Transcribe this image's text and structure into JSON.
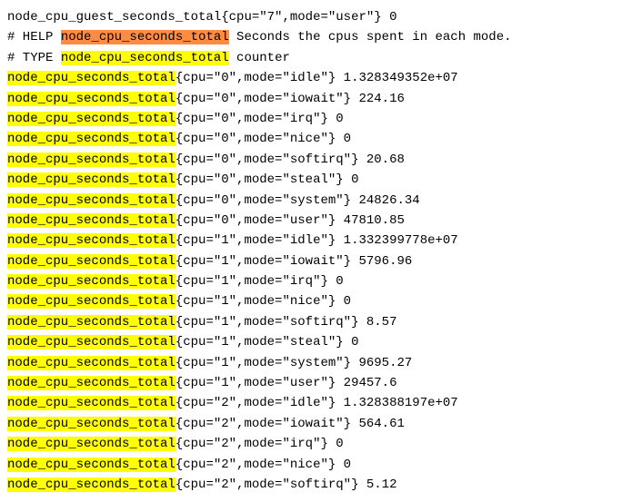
{
  "metric_name": "node_cpu_seconds_total",
  "guest_metric_name": "node_cpu_guest_seconds_total",
  "help_prefix": "# HELP ",
  "help_text": " Seconds the cpus spent in each mode.",
  "type_prefix": "# TYPE ",
  "type_value": " counter",
  "guest_line_suffix": "{cpu=\"7\",mode=\"user\"} 0",
  "metrics": [
    {
      "cpu": "0",
      "mode": "idle",
      "value": "1.328349352e+07"
    },
    {
      "cpu": "0",
      "mode": "iowait",
      "value": "224.16"
    },
    {
      "cpu": "0",
      "mode": "irq",
      "value": "0"
    },
    {
      "cpu": "0",
      "mode": "nice",
      "value": "0"
    },
    {
      "cpu": "0",
      "mode": "softirq",
      "value": "20.68"
    },
    {
      "cpu": "0",
      "mode": "steal",
      "value": "0"
    },
    {
      "cpu": "0",
      "mode": "system",
      "value": "24826.34"
    },
    {
      "cpu": "0",
      "mode": "user",
      "value": "47810.85"
    },
    {
      "cpu": "1",
      "mode": "idle",
      "value": "1.332399778e+07"
    },
    {
      "cpu": "1",
      "mode": "iowait",
      "value": "5796.96"
    },
    {
      "cpu": "1",
      "mode": "irq",
      "value": "0"
    },
    {
      "cpu": "1",
      "mode": "nice",
      "value": "0"
    },
    {
      "cpu": "1",
      "mode": "softirq",
      "value": "8.57"
    },
    {
      "cpu": "1",
      "mode": "steal",
      "value": "0"
    },
    {
      "cpu": "1",
      "mode": "system",
      "value": "9695.27"
    },
    {
      "cpu": "1",
      "mode": "user",
      "value": "29457.6"
    },
    {
      "cpu": "2",
      "mode": "idle",
      "value": "1.328388197e+07"
    },
    {
      "cpu": "2",
      "mode": "iowait",
      "value": "564.61"
    },
    {
      "cpu": "2",
      "mode": "irq",
      "value": "0"
    },
    {
      "cpu": "2",
      "mode": "nice",
      "value": "0"
    },
    {
      "cpu": "2",
      "mode": "softirq",
      "value": "5.12"
    }
  ]
}
